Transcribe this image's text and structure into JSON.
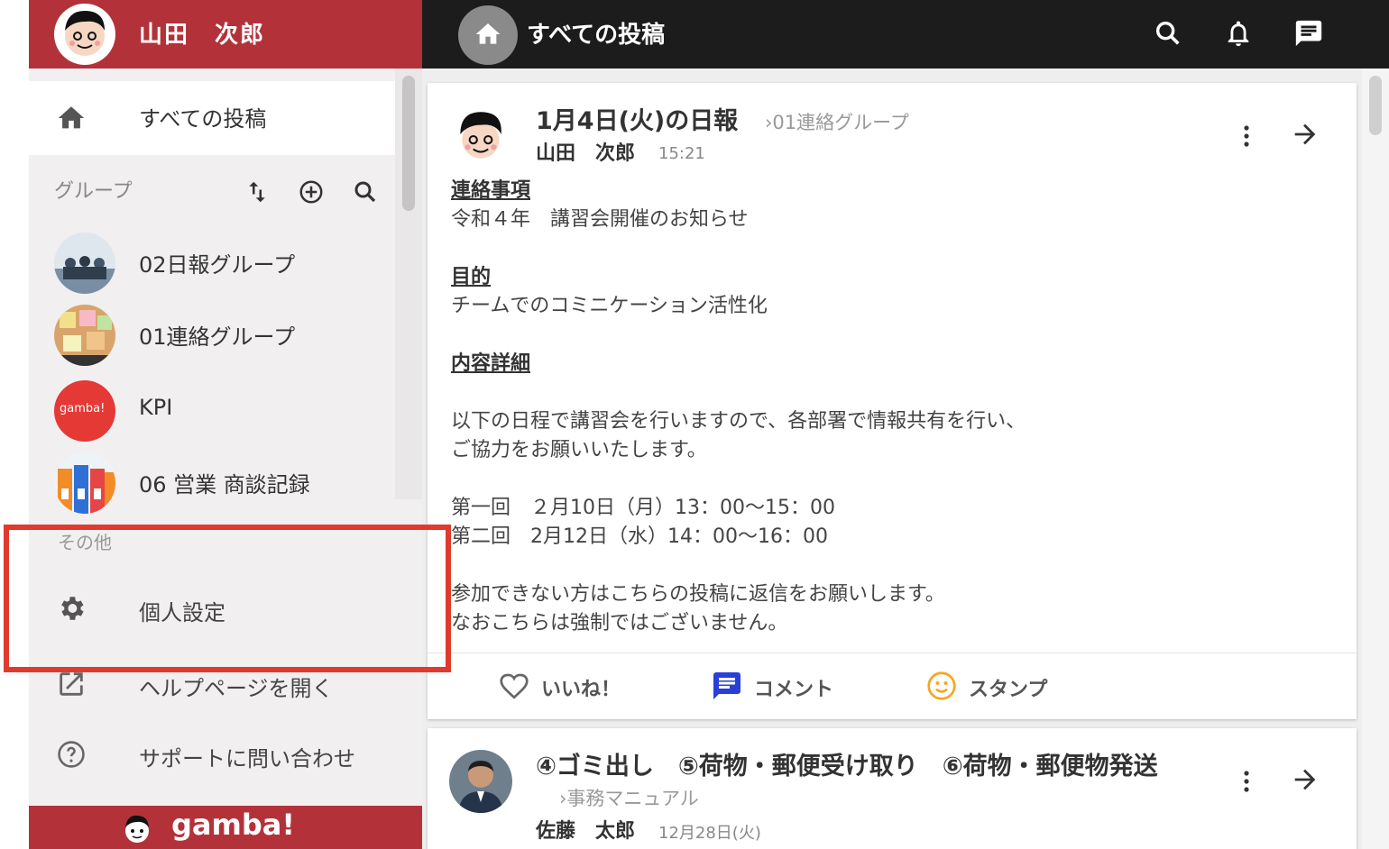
{
  "user": {
    "name": "山田　次郎"
  },
  "topbar": {
    "title": "すべての投稿",
    "icons": [
      "home-icon",
      "search-icon",
      "bell-icon",
      "chat-icon"
    ]
  },
  "sidebar": {
    "all_posts_label": "すべての投稿",
    "groups_header": "グループ",
    "groups": [
      {
        "label": "02日報グループ"
      },
      {
        "label": "01連絡グループ"
      },
      {
        "label": "KPI",
        "avatar_text": "gamba!"
      },
      {
        "label": "06 営業 商談記録"
      }
    ],
    "other_header": "その他",
    "items": [
      {
        "label": "個人設定",
        "icon": "gear-icon"
      },
      {
        "label": "ヘルプページを開く",
        "icon": "external-link-icon"
      },
      {
        "label": "サポートに問い合わせ",
        "icon": "help-icon"
      }
    ],
    "footer_logo": "gamba!"
  },
  "posts": [
    {
      "title": "1月4日(火)の日報",
      "group": "›01連絡グループ",
      "author": "山田　次郎",
      "time": "15:21",
      "body": [
        {
          "type": "head",
          "text": "連絡事項"
        },
        {
          "type": "text",
          "text": "令和４年　講習会開催のお知らせ"
        },
        {
          "type": "gap"
        },
        {
          "type": "head",
          "text": "目的"
        },
        {
          "type": "text",
          "text": "チームでのコミニケーション活性化"
        },
        {
          "type": "gap"
        },
        {
          "type": "head",
          "text": "内容詳細"
        },
        {
          "type": "gap"
        },
        {
          "type": "text",
          "text": "以下の日程で講習会を行いますので、各部署で情報共有を行い、"
        },
        {
          "type": "text",
          "text": "ご協力をお願いいたします。"
        },
        {
          "type": "gap"
        },
        {
          "type": "text",
          "text": "第一回　２月10日（月）13：00〜15：00"
        },
        {
          "type": "text",
          "text": "第二回　2月12日（水）14：00〜16：00"
        },
        {
          "type": "gap"
        },
        {
          "type": "text",
          "text": "参加できない方はこちらの投稿に返信をお願いします。"
        },
        {
          "type": "text",
          "text": "なおこちらは強制ではございません。"
        }
      ],
      "actions": {
        "like": "いいね！",
        "comment": "コメント",
        "stamp": "スタンプ"
      }
    },
    {
      "title": "④ゴミ出し　⑤荷物・郵便受け取り　⑥荷物・郵便物発送",
      "group": "›事務マニュアル",
      "author": "佐藤　太郎",
      "time": "12月28日(火)"
    }
  ],
  "colors": {
    "brand_red": "#b3323a",
    "topbar": "#1c1c1c",
    "highlight": "#e03a2e",
    "comment_blue": "#2a3fd6",
    "stamp_orange": "#f5a623"
  }
}
